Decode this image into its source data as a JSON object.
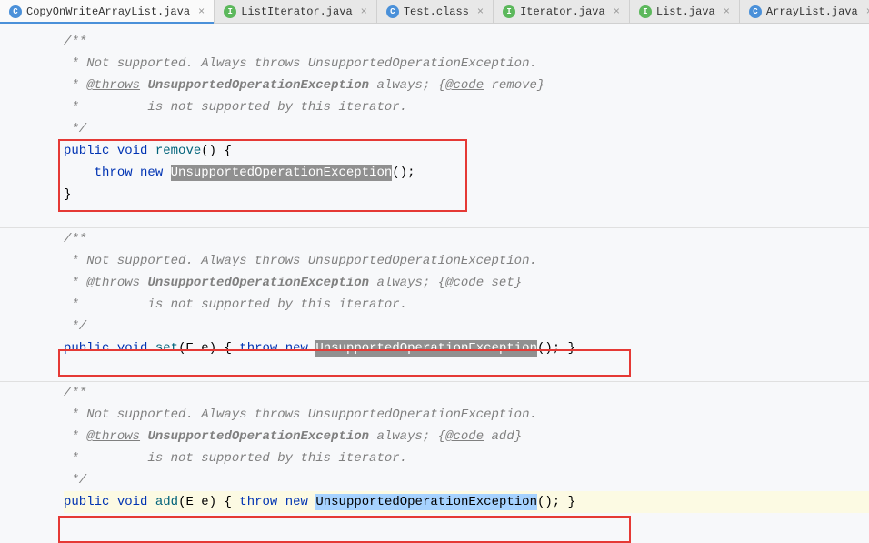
{
  "tabs": [
    {
      "icon": "C",
      "iconClass": "icon-class",
      "label": "CopyOnWriteArrayList.java",
      "active": true
    },
    {
      "icon": "I",
      "iconClass": "icon-interface",
      "label": "ListIterator.java"
    },
    {
      "icon": "C",
      "iconClass": "icon-class",
      "label": "Test.class"
    },
    {
      "icon": "I",
      "iconClass": "icon-interface",
      "label": "Iterator.java"
    },
    {
      "icon": "I",
      "iconClass": "icon-interface",
      "label": "List.java"
    },
    {
      "icon": "C",
      "iconClass": "icon-class",
      "label": "ArrayList.java"
    }
  ],
  "code": {
    "blocks": [
      {
        "doc": {
          "open": "/**",
          "line1_pre": " * Not supported. Always throws UnsupportedOperationException.",
          "line2_pre": " * ",
          "tag": "@throws",
          "exc": "UnsupportedOperationException",
          "line2_mid": " always; {",
          "codeTag": "@code",
          "codeVal": " remove}",
          "line3": " *         is not supported by this iterator.",
          "close": " */"
        },
        "sig": {
          "public": "public",
          "void": "void",
          "name": "remove",
          "params": "()",
          "open": " {"
        },
        "body_throw": "throw",
        "body_new": "new",
        "body_exc": "UnsupportedOperationException",
        "body_end": "();",
        "close": "}"
      },
      {
        "doc": {
          "open": "/**",
          "line1_pre": " * Not supported. Always throws UnsupportedOperationException.",
          "line2_pre": " * ",
          "tag": "@throws",
          "exc": "UnsupportedOperationException",
          "line2_mid": " always; {",
          "codeTag": "@code",
          "codeVal": " set}",
          "line3": " *         is not supported by this iterator.",
          "close": " */"
        },
        "sig": {
          "public": "public",
          "void": "void",
          "name": "set",
          "paramType": "E",
          "paramName": "e"
        },
        "body_throw": "throw",
        "body_new": "new",
        "body_exc": "UnsupportedOperationException",
        "body_end": "(); }"
      },
      {
        "doc": {
          "open": "/**",
          "line1_pre": " * Not supported. Always throws UnsupportedOperationException.",
          "line2_pre": " * ",
          "tag": "@throws",
          "exc": "UnsupportedOperationException",
          "line2_mid": " always; {",
          "codeTag": "@code",
          "codeVal": " add}",
          "line3": " *         is not supported by this iterator.",
          "close": " */"
        },
        "sig": {
          "public": "public",
          "void": "void",
          "name": "add",
          "paramType": "E",
          "paramName": "e"
        },
        "body_throw": "throw",
        "body_new": "new",
        "body_exc": "UnsupportedOperationException",
        "body_end": "(); }"
      }
    ]
  }
}
